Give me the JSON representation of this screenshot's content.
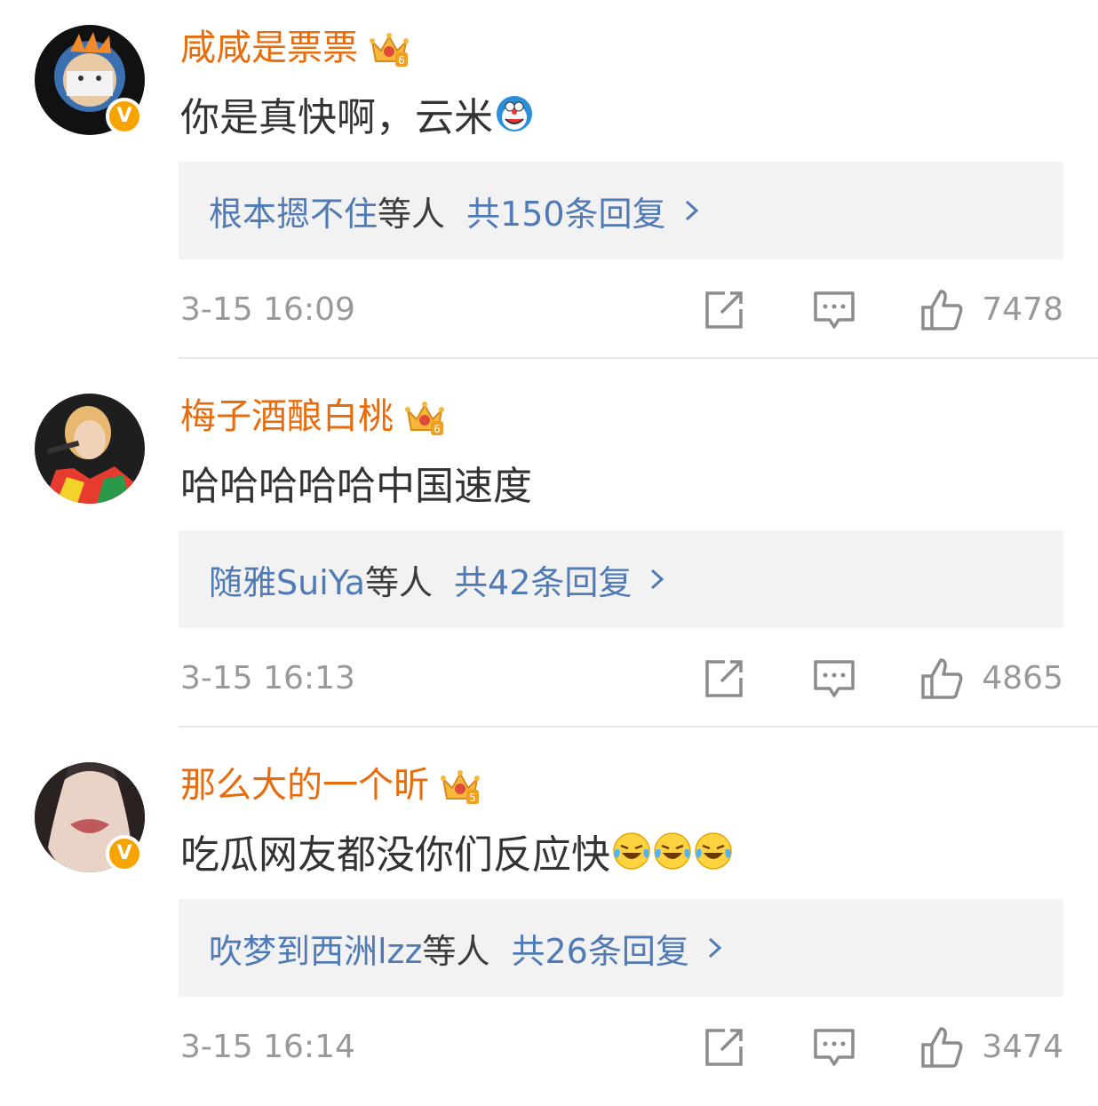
{
  "comments": [
    {
      "username": "咸咸是票票",
      "level": "6",
      "text": "你是真快啊，云米",
      "emojis": [
        "doraemon-emoji"
      ],
      "verified": true,
      "reply_users": "根本摁不住",
      "reply_suffix": "等人",
      "reply_total": "共150条回复",
      "time": "3-15 16:09",
      "likes": "7478"
    },
    {
      "username": "梅子酒酿白桃",
      "level": "6",
      "text": "哈哈哈哈哈中国速度",
      "emojis": [],
      "verified": false,
      "reply_users": "随雅SuiYa",
      "reply_suffix": "等人",
      "reply_total": "共42条回复",
      "time": "3-15 16:13",
      "likes": "4865"
    },
    {
      "username": "那么大的一个昕",
      "level": "5",
      "text": "吃瓜网友都没你们反应快",
      "emojis": [
        "laugh-cry-emoji",
        "laugh-cry-emoji",
        "laugh-cry-emoji"
      ],
      "verified": true,
      "reply_users": "吹梦到西洲lzz",
      "reply_suffix": "等人",
      "reply_total": "共26条回复",
      "time": "3-15 16:14",
      "likes": "3474"
    }
  ],
  "icons": {
    "share": "share-icon",
    "comment": "comment-icon",
    "like": "like-icon",
    "crown": "vip-crown-icon",
    "verified": "verified-v-icon"
  },
  "colors": {
    "username": "#e86b0c",
    "link": "#4f7ab6",
    "meta": "#999999",
    "reply_bg": "#f2f2f2"
  }
}
